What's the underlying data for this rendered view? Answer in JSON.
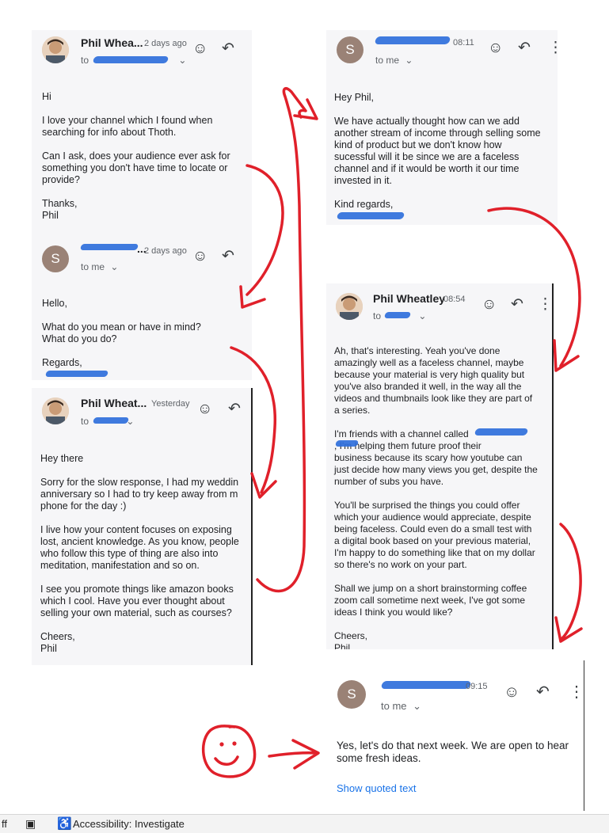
{
  "emails": [
    {
      "sender": "Phil Whea...",
      "time": "2 days ago",
      "to": "to",
      "body": [
        "Hi",
        "I love your channel which I found when\nsearching for info about Thoth.",
        "Can I ask, does your audience ever ask for\nsomething you don't have time to locate or\nprovide?",
        "Thanks,\nPhil"
      ]
    },
    {
      "sender": "S",
      "time": "2 days ago",
      "to": "to me",
      "avatar": "S",
      "body": [
        "Hello,",
        "What do you mean or have in mind?\nWhat do you do?",
        "Regards,"
      ]
    },
    {
      "sender": "Phil Wheat...",
      "time": "Yesterday",
      "to": "to",
      "body": [
        "Hey there",
        "Sorry for the slow response, I had my weddin\nanniversary so I had to try keep away from m\nphone for the day :)",
        "I live how your content focuses on exposing\nlost, ancient knowledge. As you know, people\nwho follow this type of thing are also into\nmeditation, manifestation and so on.",
        "I see you promote things like amazon books\nwhich I cool.  Have you ever thought about\nselling your own material, such as courses?",
        "Cheers,\nPhil"
      ]
    },
    {
      "sender": "S",
      "time": "08:11",
      "to": "to me",
      "avatar": "S",
      "body": [
        "Hey Phil,",
        "We have actually thought how can we add\nanother stream of income through selling some\nkind of product but we don't know how\nsucessful will it be since we are a faceless\nchannel and if it would be worth it our time\ninvested in it.",
        "Kind regards,"
      ]
    },
    {
      "sender": "Phil Wheatley",
      "time": "08:54",
      "to": "to",
      "body": [
        "Ah, that's interesting. Yeah you've done\namazingly well as a faceless channel, maybe\nbecause your material is very high quality but\nyou've also branded it well, in the way all the\nvideos and thumbnails look like they are part of\na series.",
        "I'm friends with a channel called\n, I'm helping them future proof their\nbusiness because its scary how youtube can\njust decide how many views you get, despite the\nnumber of subs you have.",
        "You'll be surprised the things you could offer\nwhich your audience would appreciate, despite\nbeing faceless. Could even do a small test with\na digital book based on your previous material,\nI'm happy to do something like that on my dollar\nso there's no work on your part.",
        "Shall we jump on a short brainstorming coffee\nzoom call sometime next week, I've got some\nideas I think you would like?",
        "Cheers,\nPhil"
      ]
    },
    {
      "sender": "S",
      "time": "09:15",
      "to": "to me",
      "avatar": "S",
      "body": [
        "Yes, let's do that next week. We are open to hear\nsome fresh ideas."
      ],
      "show_quoted": "Show quoted text"
    }
  ],
  "status_bar": {
    "left_fragment": "ff",
    "accessibility": "Accessibility: Investigate"
  },
  "colors": {
    "annotation_red": "#e0202a",
    "redaction_blue": "#2f6fdb",
    "link_blue": "#1a73e8"
  },
  "icons": [
    "emoji-icon",
    "reply-icon",
    "more-vert-icon",
    "chevron-down-icon",
    "focus-mode-icon",
    "accessibility-icon"
  ]
}
